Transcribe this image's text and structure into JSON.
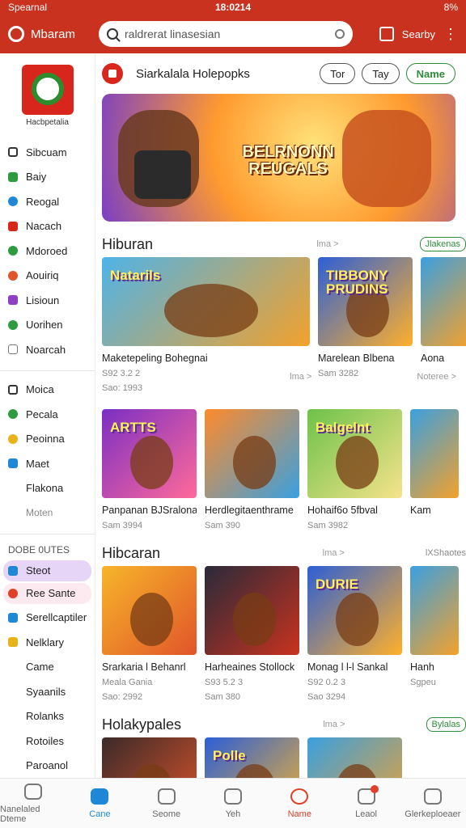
{
  "status": {
    "left": "Spearnal",
    "time": "18:0214",
    "right": "8%"
  },
  "appbar": {
    "app_name": "Mbaram",
    "search_placeholder": "raldrerat linasesian",
    "action_label": "Searby"
  },
  "sidebar": {
    "brand_name": "Hacbpetalia",
    "items": [
      {
        "label": "Sibcuam",
        "icon": "square-icon",
        "color": "#333333"
      },
      {
        "label": "Baiy",
        "icon": "arrow-icon",
        "color": "#2e9b3e"
      },
      {
        "label": "Reogal",
        "icon": "circle-icon",
        "color": "#1e88d6"
      },
      {
        "label": "Nacach",
        "icon": "house-icon",
        "color": "#d9261c"
      },
      {
        "label": "Mdoroed",
        "icon": "check-icon",
        "color": "#2e9b3e"
      },
      {
        "label": "Aouiriq",
        "icon": "flame-icon",
        "color": "#e0552a"
      },
      {
        "label": "Lisioun",
        "icon": "puzzle-icon",
        "color": "#8e3fc4"
      },
      {
        "label": "Uorihen",
        "icon": "check-icon",
        "color": "#2e9b3e"
      },
      {
        "label": "Noarcah",
        "icon": "box-icon",
        "color": "#777777"
      }
    ],
    "items2": [
      {
        "label": "Moica",
        "icon": "square-icon",
        "color": "#333333"
      },
      {
        "label": "Pecala",
        "icon": "dot-icon",
        "color": "#2e9b3e"
      },
      {
        "label": "Peoinna",
        "icon": "dot-icon",
        "color": "#e8b21a"
      },
      {
        "label": "Maet",
        "icon": "square-icon",
        "color": "#1e88d6"
      },
      {
        "label": "Flakona",
        "icon": "",
        "color": ""
      },
      {
        "label": "Moten",
        "icon": "",
        "color": ""
      }
    ],
    "section_head": "DOBE 0UTES",
    "items3": [
      {
        "label": "Steot",
        "icon": "square-icon",
        "color": "#1e88d6",
        "bg": "#e7d5f7"
      },
      {
        "label": "Ree Sante",
        "icon": "dot-icon",
        "color": "#e0402a",
        "bg": "#fdeaf0"
      },
      {
        "label": "Serellcaptiler",
        "icon": "square-icon",
        "color": "#1e88d6",
        "bg": ""
      },
      {
        "label": "Nelklary",
        "icon": "square-icon",
        "color": "#e8b21a",
        "bg": ""
      },
      {
        "label": "Came",
        "icon": "",
        "color": "",
        "bg": ""
      },
      {
        "label": "Syaanils",
        "icon": "",
        "color": "",
        "bg": ""
      },
      {
        "label": "Rolanks",
        "icon": "",
        "color": "",
        "bg": ""
      },
      {
        "label": "Rotoiles",
        "icon": "",
        "color": "",
        "bg": ""
      },
      {
        "label": "Paroanol",
        "icon": "",
        "color": "",
        "bg": ""
      }
    ]
  },
  "featured": {
    "title": "Siarkalala Holepopks",
    "chips": [
      "Tor",
      "Tay",
      "Name"
    ],
    "banner_text": "BELRNONN REUGALS"
  },
  "sections": [
    {
      "title": "Hiburan",
      "more": "lma >",
      "badge": "Jlakenas",
      "cards": [
        {
          "title": "Maketepeling Bohegnai",
          "sub": "S92 3.2 2",
          "sub2": "Sao: 1993",
          "tag": "Natarils",
          "bg1": "#4fb3e8",
          "bg2": "#f3a12b",
          "wide": true
        },
        {
          "title": "Marelean Blbena",
          "sub": "Sam 3282",
          "sub2": "",
          "tag": "TIBBONY PRUDINS",
          "bg1": "#2c5fd6",
          "bg2": "#ffb02a",
          "wide": false
        }
      ],
      "extra_title": "Aona",
      "row_meta": "lma >",
      "row_badge": "Noteree >"
    },
    {
      "title": "",
      "more": "",
      "badge": "",
      "cards": [
        {
          "title": "Panpanan BJSralona",
          "sub": "Sam 3994",
          "sub2": "",
          "tag": "ARTTS",
          "bg1": "#7b2fc4",
          "bg2": "#ff6a9a",
          "wide": false
        },
        {
          "title": "Herdlegitaenthrame",
          "sub": "Sam 390",
          "sub2": "",
          "tag": "",
          "bg1": "#ff8a2a",
          "bg2": "#3aa0e0",
          "wide": false
        },
        {
          "title": "Hohaif6o 5fbval",
          "sub": "Sam 3982",
          "sub2": "",
          "tag": "Balgelnt",
          "bg1": "#6cc24a",
          "bg2": "#f6e38a",
          "wide": false
        }
      ],
      "extra_title": "Kam"
    },
    {
      "title": "Hibcaran",
      "more": "lma >",
      "badge": "lXShaotes",
      "cards": [
        {
          "title": "Srarkaria l Behanrl",
          "sub": "Meala Gania",
          "sub2": "Sao: 2992",
          "tag": "",
          "bg1": "#f7b52a",
          "bg2": "#e0552a",
          "wide": false
        },
        {
          "title": "Harheaines Stollock",
          "sub": "S93 5.2 3",
          "sub2": "Sam 380",
          "tag": "",
          "bg1": "#2a2a3a",
          "bg2": "#c8321f",
          "wide": false
        },
        {
          "title": "Monag l l-l Sankal",
          "sub": "S92 0.2 3",
          "sub2": "Sao 3294",
          "tag": "DURIE",
          "bg1": "#2c5fd6",
          "bg2": "#ffb02a",
          "wide": false
        }
      ],
      "extra_title": "Hanh",
      "extra_sub": "Sgpeu"
    },
    {
      "title": "Holakypales",
      "more": "lma >",
      "badge": "Bylalas",
      "cards": [
        {
          "title": "",
          "sub": "",
          "sub2": "",
          "tag": "",
          "bg1": "#3a2a2a",
          "bg2": "#e0552a",
          "wide": false
        },
        {
          "title": "",
          "sub": "",
          "sub2": "",
          "tag": "Polle",
          "bg1": "#2c5fd6",
          "bg2": "#f7b52a",
          "wide": false
        },
        {
          "title": "",
          "sub": "",
          "sub2": "",
          "tag": "",
          "bg1": "#3aa0e0",
          "bg2": "#f3a12b",
          "wide": false
        }
      ],
      "extra_title": ""
    }
  ],
  "bottom_nav": [
    {
      "label": "Nanelaled Dteme",
      "icon": "home-icon",
      "state": ""
    },
    {
      "label": "Cane",
      "icon": "game-icon",
      "state": "active"
    },
    {
      "label": "Seome",
      "icon": "compass-icon",
      "state": ""
    },
    {
      "label": "Yeh",
      "icon": "bolt-icon",
      "state": ""
    },
    {
      "label": "Name",
      "icon": "profile-icon",
      "state": "red"
    },
    {
      "label": "Leaol",
      "icon": "chat-icon",
      "state": "badge"
    },
    {
      "label": "Glerkeploeaer",
      "icon": "gamepad-icon",
      "state": ""
    }
  ]
}
